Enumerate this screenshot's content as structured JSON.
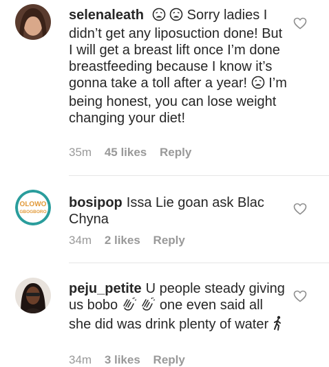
{
  "comments": [
    {
      "username": "selenaleath",
      "text_parts": [
        "Sorry ladies I didn’t get any liposuction done!   But I will get a breast lift once I’m done breastfeeding because I know it’s gonna take a toll after a year!",
        "I’m being honest, you can lose weight changing your diet!"
      ],
      "time": "35m",
      "likes": "45 likes",
      "reply": "Reply",
      "icons": [
        "weary-face-icon",
        "weary-face-icon",
        "weary-face-icon"
      ]
    },
    {
      "username": "bosipop",
      "text": "Issa Lie goan ask Blac Chyna",
      "time": "34m",
      "likes": "2 likes",
      "reply": "Reply",
      "avatar_text": [
        "OLOWO",
        "GBOGBORO"
      ]
    },
    {
      "username": "peju_petite",
      "text_parts": [
        "U people steady giving us bobo",
        "one even said all she did was drink plenty of water"
      ],
      "time": "34m",
      "likes": "3 likes",
      "reply": "Reply",
      "icons": [
        "clapping-hands-icon",
        "clapping-hands-icon",
        "walking-person-icon"
      ]
    }
  ],
  "colors": {
    "text": "#262626",
    "meta": "#999999",
    "divider": "#e6e6e6",
    "heart_outline": "#8e8e8e",
    "avatar_ring": "#2a9d9c"
  }
}
